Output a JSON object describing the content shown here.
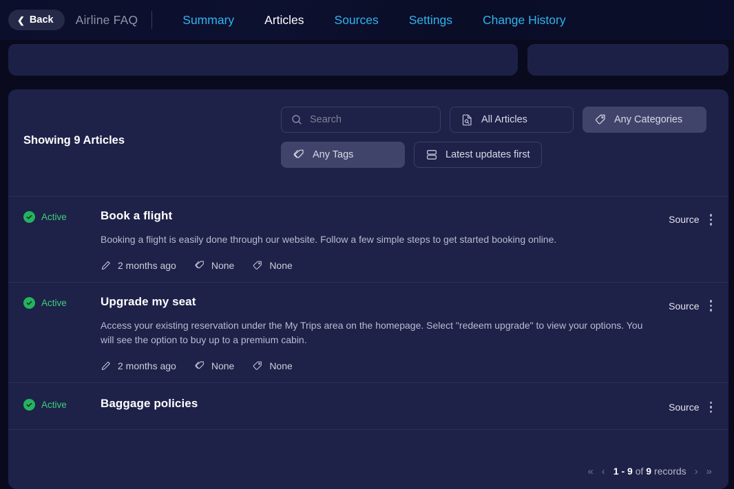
{
  "nav": {
    "back_label": "Back",
    "back_icon": "chevron-left-icon",
    "breadcrumb": "Airline FAQ",
    "links": [
      {
        "label": "Summary",
        "active": false
      },
      {
        "label": "Articles",
        "active": true
      },
      {
        "label": "Sources",
        "active": false
      },
      {
        "label": "Settings",
        "active": false
      },
      {
        "label": "Change History",
        "active": false
      }
    ]
  },
  "colors": {
    "page_bg": "#0a0a1f",
    "panel_bg": "#1e2148",
    "link": "#2fb4f0",
    "active_status": "#3ed07d",
    "status_dot": "#24b35f",
    "filter_filled": "#40446a",
    "divider": "#2c3059"
  },
  "toolbar": {
    "showing_label": "Showing 9 Articles",
    "search": {
      "placeholder": "Search",
      "value": "",
      "icon": "search-icon"
    },
    "filters": [
      {
        "label": "All Articles",
        "icon": "document-search-icon",
        "filled": false
      },
      {
        "label": "Any Categories",
        "icon": "tag-icon",
        "filled": true
      },
      {
        "label": "Any Tags",
        "icon": "tags-icon",
        "filled": true
      },
      {
        "label": "Latest updates first",
        "icon": "sort-rows-icon",
        "filled": false
      }
    ]
  },
  "articles": [
    {
      "status": "Active",
      "title": "Book a flight",
      "description": "Booking a flight is easily done through our website. Follow a few simple steps to get started booking online.",
      "updated": "2 months ago",
      "category": "None",
      "tag": "None",
      "source_label": "Source"
    },
    {
      "status": "Active",
      "title": "Upgrade my seat",
      "description": "Access your existing reservation under the My Trips area on the homepage. Select \"redeem upgrade\" to view your options. You will see the option to buy up to a premium cabin.",
      "updated": "2 months ago",
      "category": "None",
      "tag": "None",
      "source_label": "Source"
    },
    {
      "status": "Active",
      "title": "Baggage policies",
      "description": "",
      "updated": "",
      "category": "",
      "tag": "",
      "source_label": "Source"
    }
  ],
  "pagination": {
    "first_icon": "«",
    "prev_icon": "‹",
    "range": "1 - 9",
    "of_label": "of",
    "total": "9",
    "records_label": "records",
    "next_icon": "›",
    "last_icon": "»"
  }
}
